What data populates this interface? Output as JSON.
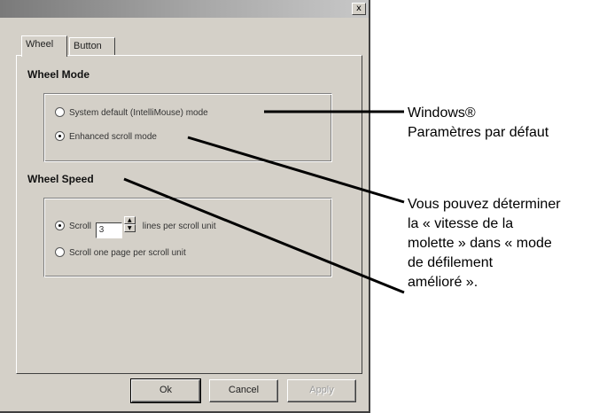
{
  "dialog": {
    "close_glyph": "x",
    "tabs": [
      {
        "label": "Wheel"
      },
      {
        "label": "Button"
      }
    ],
    "wheel_mode": {
      "title": "Wheel Mode",
      "options": [
        {
          "label": "System default (IntelliMouse) mode",
          "checked": false
        },
        {
          "label": "Enhanced scroll mode",
          "checked": true
        }
      ]
    },
    "wheel_speed": {
      "title": "Wheel Speed",
      "scroll_label": "Scroll",
      "scroll_value": "3",
      "scroll_suffix": "lines per scroll unit",
      "page_label": "Scroll one page per scroll unit"
    },
    "buttons": {
      "ok": "Ok",
      "cancel": "Cancel",
      "apply": "Apply"
    }
  },
  "annotations": {
    "first_line1": "Windows®",
    "first_line2": "Paramètres par défaut",
    "second_lines": [
      "Vous pouvez déterminer",
      "la «  vitesse de la",
      "molette  » dans « mode",
      "de défilement",
      "amélioré  »."
    ]
  }
}
